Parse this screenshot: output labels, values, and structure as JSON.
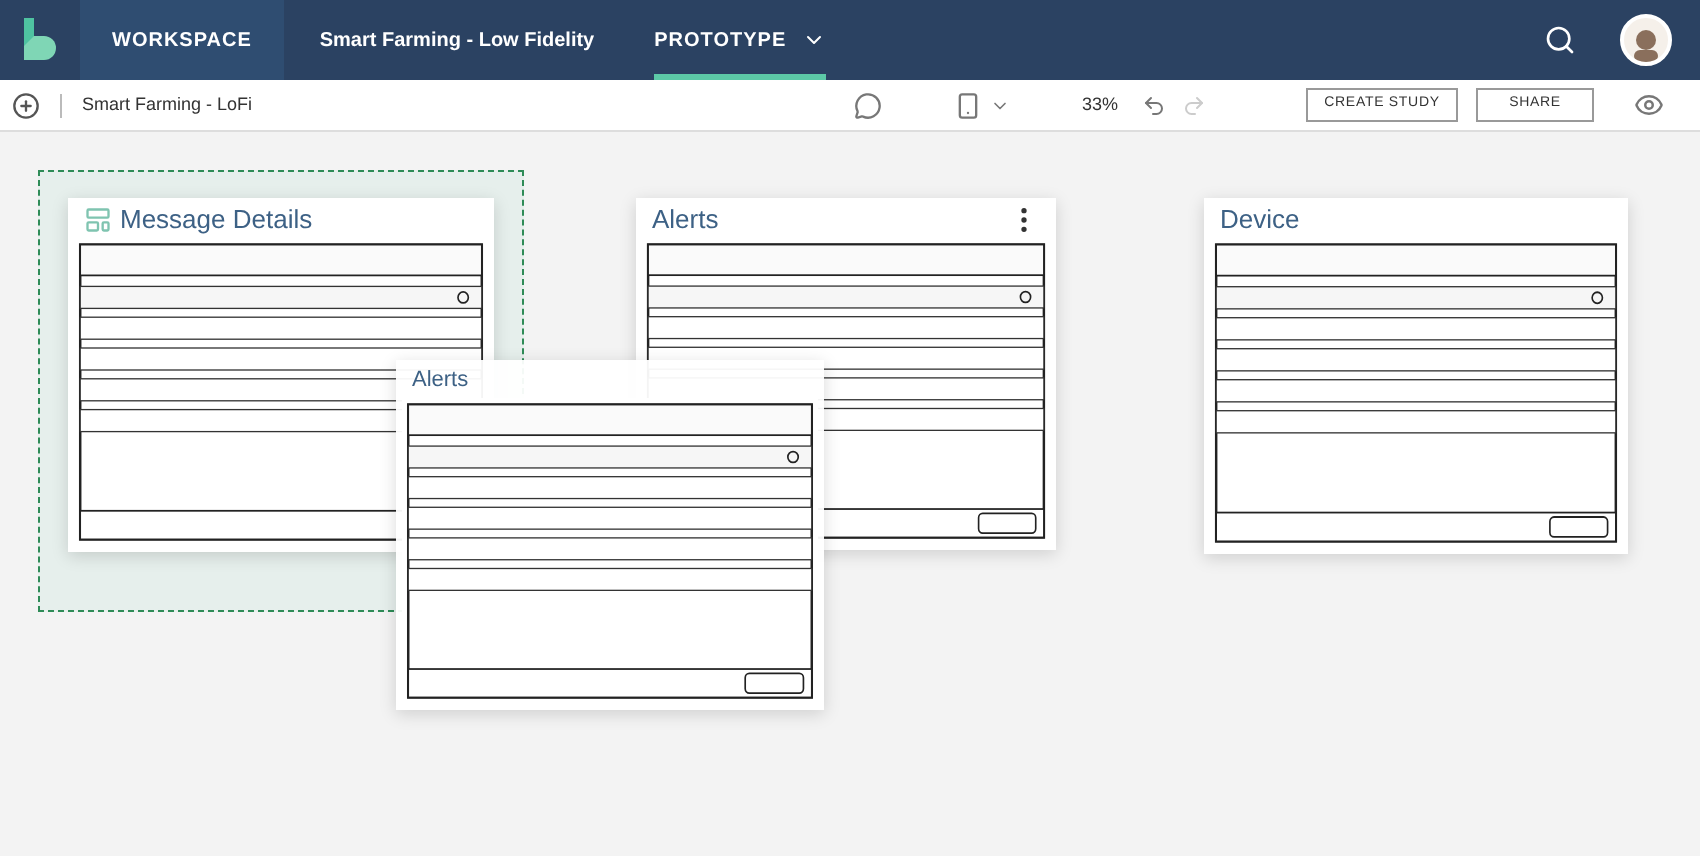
{
  "header": {
    "workspace": "WORKSPACE",
    "project": "Smart Farming - Low Fidelity",
    "mode": "PROTOTYPE"
  },
  "toolbar": {
    "title": "Smart Farming - LoFi",
    "zoom": "33%",
    "buttons": [
      "CREATE STUDY",
      "SHARE"
    ]
  },
  "screens": [
    {
      "title": "Message Details",
      "kind": "screen",
      "selected": true,
      "icon": true,
      "menu": false
    },
    {
      "title": "Alerts",
      "kind": "screen",
      "selected": false,
      "icon": false,
      "menu": true
    },
    {
      "title": "Device",
      "kind": "screen",
      "selected": false,
      "icon": false,
      "menu": false
    },
    {
      "title": "Alerts",
      "kind": "overlay",
      "selected": false,
      "icon": false,
      "menu": false
    }
  ]
}
